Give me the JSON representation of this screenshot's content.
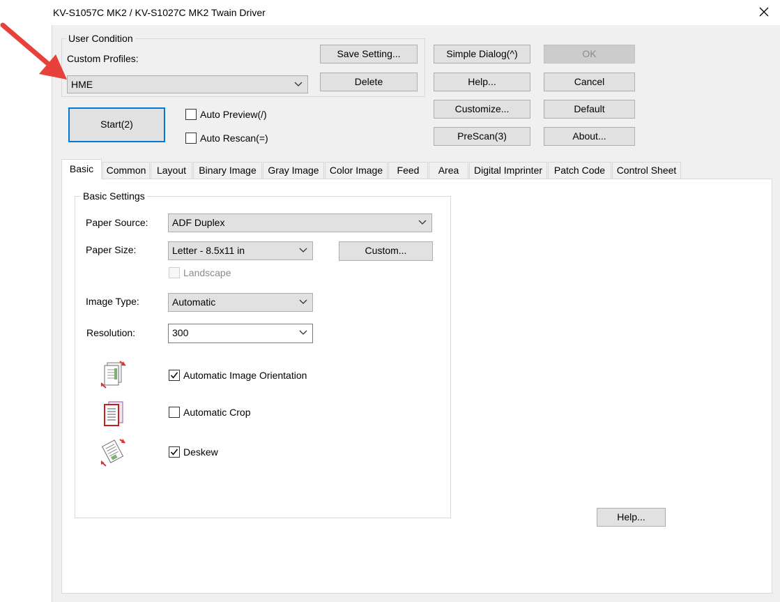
{
  "window": {
    "title": "KV-S1057C MK2 / KV-S1027C MK2 Twain Driver"
  },
  "user_condition": {
    "legend": "User Condition",
    "custom_profiles_label": "Custom Profiles:",
    "selected_profile": "HME",
    "save_setting": "Save Setting...",
    "delete": "Delete"
  },
  "buttons": {
    "simple_dialog": "Simple Dialog(^)",
    "ok": "OK",
    "help": "Help...",
    "cancel": "Cancel",
    "customize": "Customize...",
    "default": "Default",
    "prescan": "PreScan(3)",
    "about": "About...",
    "start": "Start(2)"
  },
  "options": {
    "auto_preview": {
      "label": "Auto Preview(/)",
      "checked": false
    },
    "auto_rescan": {
      "label": "Auto Rescan(=)",
      "checked": false
    }
  },
  "tabs": [
    {
      "label": "Basic",
      "active": true
    },
    {
      "label": "Common"
    },
    {
      "label": "Layout"
    },
    {
      "label": "Binary Image"
    },
    {
      "label": "Gray Image"
    },
    {
      "label": "Color Image"
    },
    {
      "label": "Feed"
    },
    {
      "label": "Area"
    },
    {
      "label": "Digital Imprinter"
    },
    {
      "label": "Patch Code"
    },
    {
      "label": "Control Sheet"
    }
  ],
  "basic": {
    "legend": "Basic Settings",
    "paper_source": {
      "label": "Paper Source:",
      "value": "ADF Duplex"
    },
    "paper_size": {
      "label": "Paper Size:",
      "value": "Letter - 8.5x11 in",
      "custom": "Custom..."
    },
    "landscape": {
      "label": "Landscape",
      "checked": false,
      "enabled": false
    },
    "image_type": {
      "label": "Image Type:",
      "value": "Automatic"
    },
    "resolution": {
      "label": "Resolution:",
      "value": "300"
    },
    "auto_orientation": {
      "label": "Automatic Image Orientation",
      "checked": true,
      "icon": "image-orientation-icon"
    },
    "auto_crop": {
      "label": "Automatic Crop",
      "checked": false,
      "icon": "auto-crop-icon"
    },
    "deskew": {
      "label": "Deskew",
      "checked": true,
      "icon": "deskew-icon"
    },
    "help": "Help..."
  },
  "colors": {
    "accent": "#0078d7",
    "annotation_arrow": "#e8403a"
  }
}
